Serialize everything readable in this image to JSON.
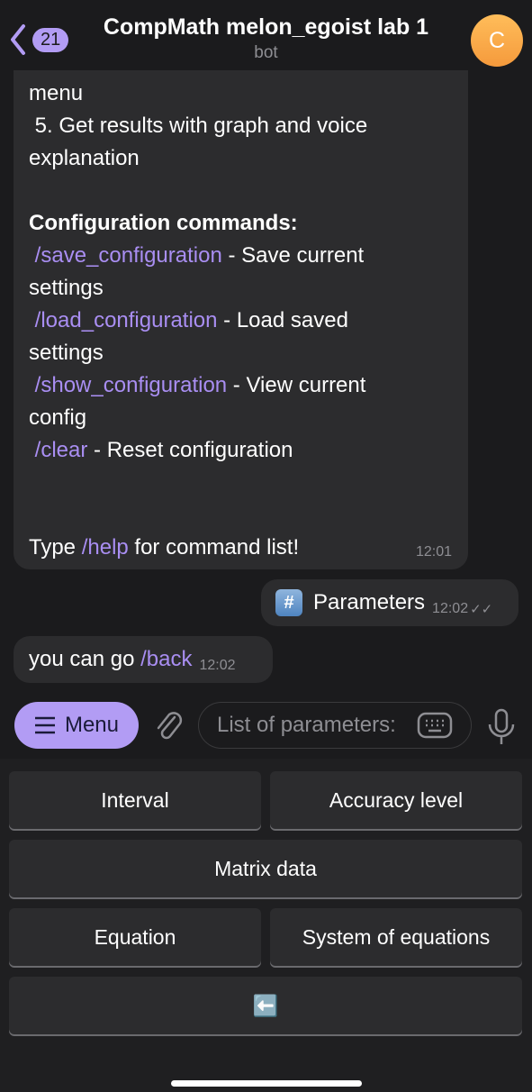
{
  "header": {
    "back_count": "21",
    "title": "CompMath melon_egoist lab 1",
    "subtitle": "bot",
    "avatar_letter": "C"
  },
  "messages": [
    {
      "lines": [
        [
          {
            "t": "menu"
          }
        ],
        [
          {
            "t": " 5. Get results with graph and voice"
          }
        ],
        [
          {
            "t": "explanation"
          }
        ],
        [
          {
            "t": ""
          }
        ],
        [
          {
            "t": "Configuration commands:",
            "b": true
          }
        ],
        [
          {
            "t": " "
          },
          {
            "t": "/save_configuration",
            "c": true
          },
          {
            "t": " - Save current"
          }
        ],
        [
          {
            "t": "settings"
          }
        ],
        [
          {
            "t": " "
          },
          {
            "t": "/load_configuration",
            "c": true
          },
          {
            "t": " - Load saved"
          }
        ],
        [
          {
            "t": "settings"
          }
        ],
        [
          {
            "t": " "
          },
          {
            "t": "/show_configuration",
            "c": true
          },
          {
            "t": " - View current"
          }
        ],
        [
          {
            "t": "config"
          }
        ],
        [
          {
            "t": " "
          },
          {
            "t": "/clear",
            "c": true
          },
          {
            "t": " - Reset configuration"
          }
        ],
        [
          {
            "t": ""
          }
        ],
        [
          {
            "t": ""
          }
        ],
        [
          {
            "t": "Type "
          },
          {
            "t": "/help",
            "c": true
          },
          {
            "t": " for command list!"
          }
        ]
      ],
      "time": "12:01"
    },
    {
      "text": "Parameters",
      "time": "12:02",
      "status": "read"
    },
    {
      "text": "you can go ",
      "command": "/back",
      "time": "12:02"
    }
  ],
  "input": {
    "menu_label": "Menu",
    "placeholder": "List of parameters:"
  },
  "keyboard": [
    "Interval",
    "Accuracy level",
    "Matrix data",
    "Equation",
    "System of equations",
    "⬅️"
  ],
  "colors": {
    "accent": "#b29cf4",
    "bubble": "#2c2c2e",
    "background": "#1b1b1d"
  }
}
